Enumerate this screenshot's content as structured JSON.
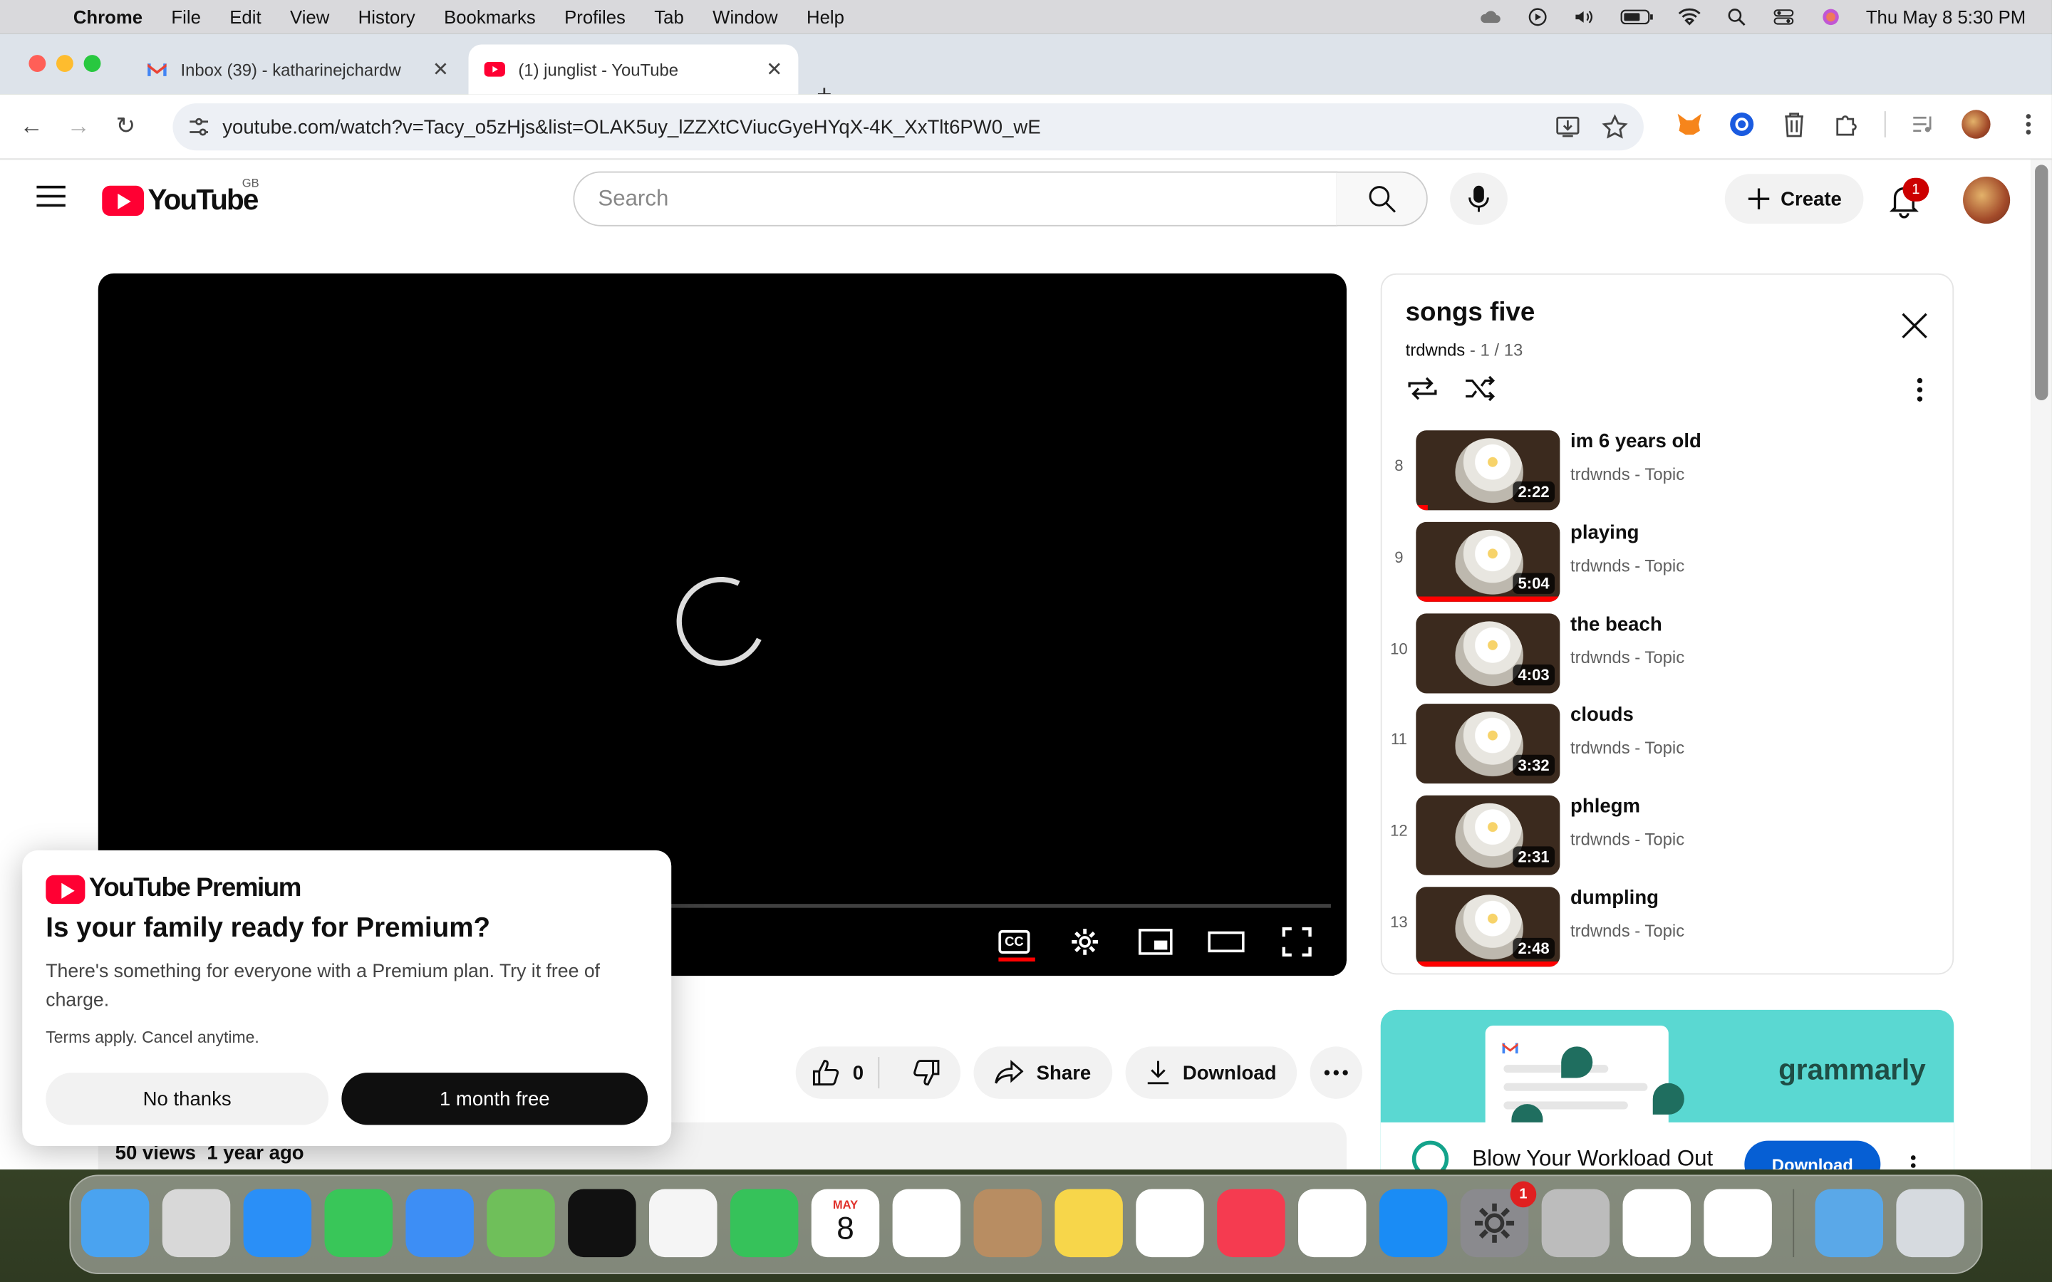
{
  "menubar": {
    "app": "Chrome",
    "items": [
      "File",
      "Edit",
      "View",
      "History",
      "Bookmarks",
      "Profiles",
      "Tab",
      "Window",
      "Help"
    ],
    "clock": "Thu May 8  5:30 PM"
  },
  "browser": {
    "tabs": [
      {
        "title": "Inbox (39) - katharinejchardw",
        "favicon": "gmail-icon"
      },
      {
        "title": "(1) junglist - YouTube",
        "favicon": "youtube-icon"
      }
    ],
    "url": "youtube.com/watch?v=Tacy_o5zHjs&list=OLAK5uy_lZZXtCViucGyeHYqX-4K_XxTlt6PW0_wE"
  },
  "youtube": {
    "region": "GB",
    "search_placeholder": "Search",
    "create_label": "Create",
    "notification_count": "1",
    "accent": "#ff0033"
  },
  "actions": {
    "likes": "0",
    "share": "Share",
    "download": "Download"
  },
  "description": {
    "views": "50 views",
    "age": "1 year ago"
  },
  "playlist": {
    "title": "songs five",
    "owner": "trdwnds",
    "position": "1 / 13",
    "items": [
      {
        "index": "8",
        "title": "im 6 years old",
        "channel": "trdwnds - Topic",
        "duration": "2:22",
        "watched": 0.08
      },
      {
        "index": "9",
        "title": "playing",
        "channel": "trdwnds - Topic",
        "duration": "5:04",
        "watched": 1.0
      },
      {
        "index": "10",
        "title": "the beach",
        "channel": "trdwnds - Topic",
        "duration": "4:03",
        "watched": 0
      },
      {
        "index": "11",
        "title": "clouds",
        "channel": "trdwnds - Topic",
        "duration": "3:32",
        "watched": 0
      },
      {
        "index": "12",
        "title": "phlegm",
        "channel": "trdwnds - Topic",
        "duration": "2:31",
        "watched": 0
      },
      {
        "index": "13",
        "title": "dumpling",
        "channel": "trdwnds - Topic",
        "duration": "2:48",
        "watched": 1.0
      }
    ]
  },
  "ad": {
    "brand": "grammarly",
    "headline": "Blow Your Workload Out",
    "cta": "Download"
  },
  "promo": {
    "brand": "YouTube Premium",
    "title": "Is your family ready for Premium?",
    "body": "There's something for everyone with a Premium plan. Try it free of charge.",
    "terms": "Terms apply. Cancel anytime.",
    "decline": "No thanks",
    "accept": "1 month free"
  },
  "dock": {
    "apps": [
      {
        "name": "finder",
        "color": "#4aa3f0"
      },
      {
        "name": "launchpad",
        "color": "#d8d8d8"
      },
      {
        "name": "safari",
        "color": "#2a8ff7"
      },
      {
        "name": "messages",
        "color": "#39c659"
      },
      {
        "name": "mail",
        "color": "#3d8ef5"
      },
      {
        "name": "maps",
        "color": "#6fbf5a"
      },
      {
        "name": "tv",
        "color": "#111111"
      },
      {
        "name": "photos",
        "color": "#f5f5f5"
      },
      {
        "name": "facetime",
        "color": "#36c25a"
      },
      {
        "name": "calendar",
        "color": "#ffffff"
      },
      {
        "name": "reminders",
        "color": "#ffffff"
      },
      {
        "name": "contacts",
        "color": "#b88d62"
      },
      {
        "name": "notes",
        "color": "#f7d64a"
      },
      {
        "name": "freeform",
        "color": "#ffffff"
      },
      {
        "name": "music",
        "color": "#f53b50"
      },
      {
        "name": "news",
        "color": "#ffffff"
      },
      {
        "name": "app-store",
        "color": "#1a8cf5"
      },
      {
        "name": "system-settings",
        "color": "#8a8a8e"
      },
      {
        "name": "iphone-mirroring",
        "color": "#bcbcbc"
      },
      {
        "name": "chrome",
        "color": "#ffffff"
      },
      {
        "name": "passwords",
        "color": "#ffffff"
      }
    ],
    "calendar_month": "MAY",
    "calendar_day": "8",
    "settings_badge": "1",
    "apps_after_separator": [
      {
        "name": "downloads-folder",
        "color": "#5aa8e8"
      },
      {
        "name": "trash",
        "color": "#d6dadf"
      }
    ]
  }
}
